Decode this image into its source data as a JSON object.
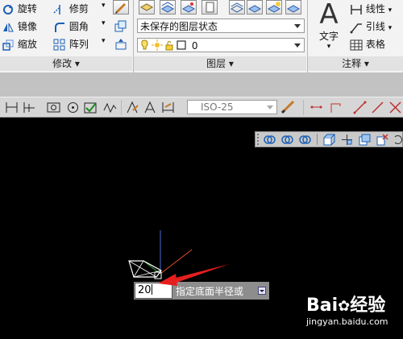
{
  "modify_panel": {
    "title": "修改",
    "rotate": "旋转",
    "mirror": "镜像",
    "scale": "缩放",
    "trim": "修剪",
    "fillet": "圆角",
    "array": "阵列"
  },
  "layers_panel": {
    "title": "图层",
    "layer_state": "未保存的图层状态",
    "current_layer": "0"
  },
  "annotation_panel": {
    "title": "注释",
    "text": "文字",
    "linear": "线性",
    "leader": "引线",
    "table": "表格"
  },
  "dimstyle": {
    "value": "ISO-25"
  },
  "command_line": {
    "input_value": "20",
    "prompt": "指定底面半径或"
  },
  "watermark": {
    "brand": "Bai",
    "brand_suffix": "经验",
    "url": "jingyan.baidu.com"
  },
  "colors": {
    "canvas": "#000000",
    "ribbon": "#f3f3f3",
    "pointer_arrow": "#e51e1e"
  }
}
